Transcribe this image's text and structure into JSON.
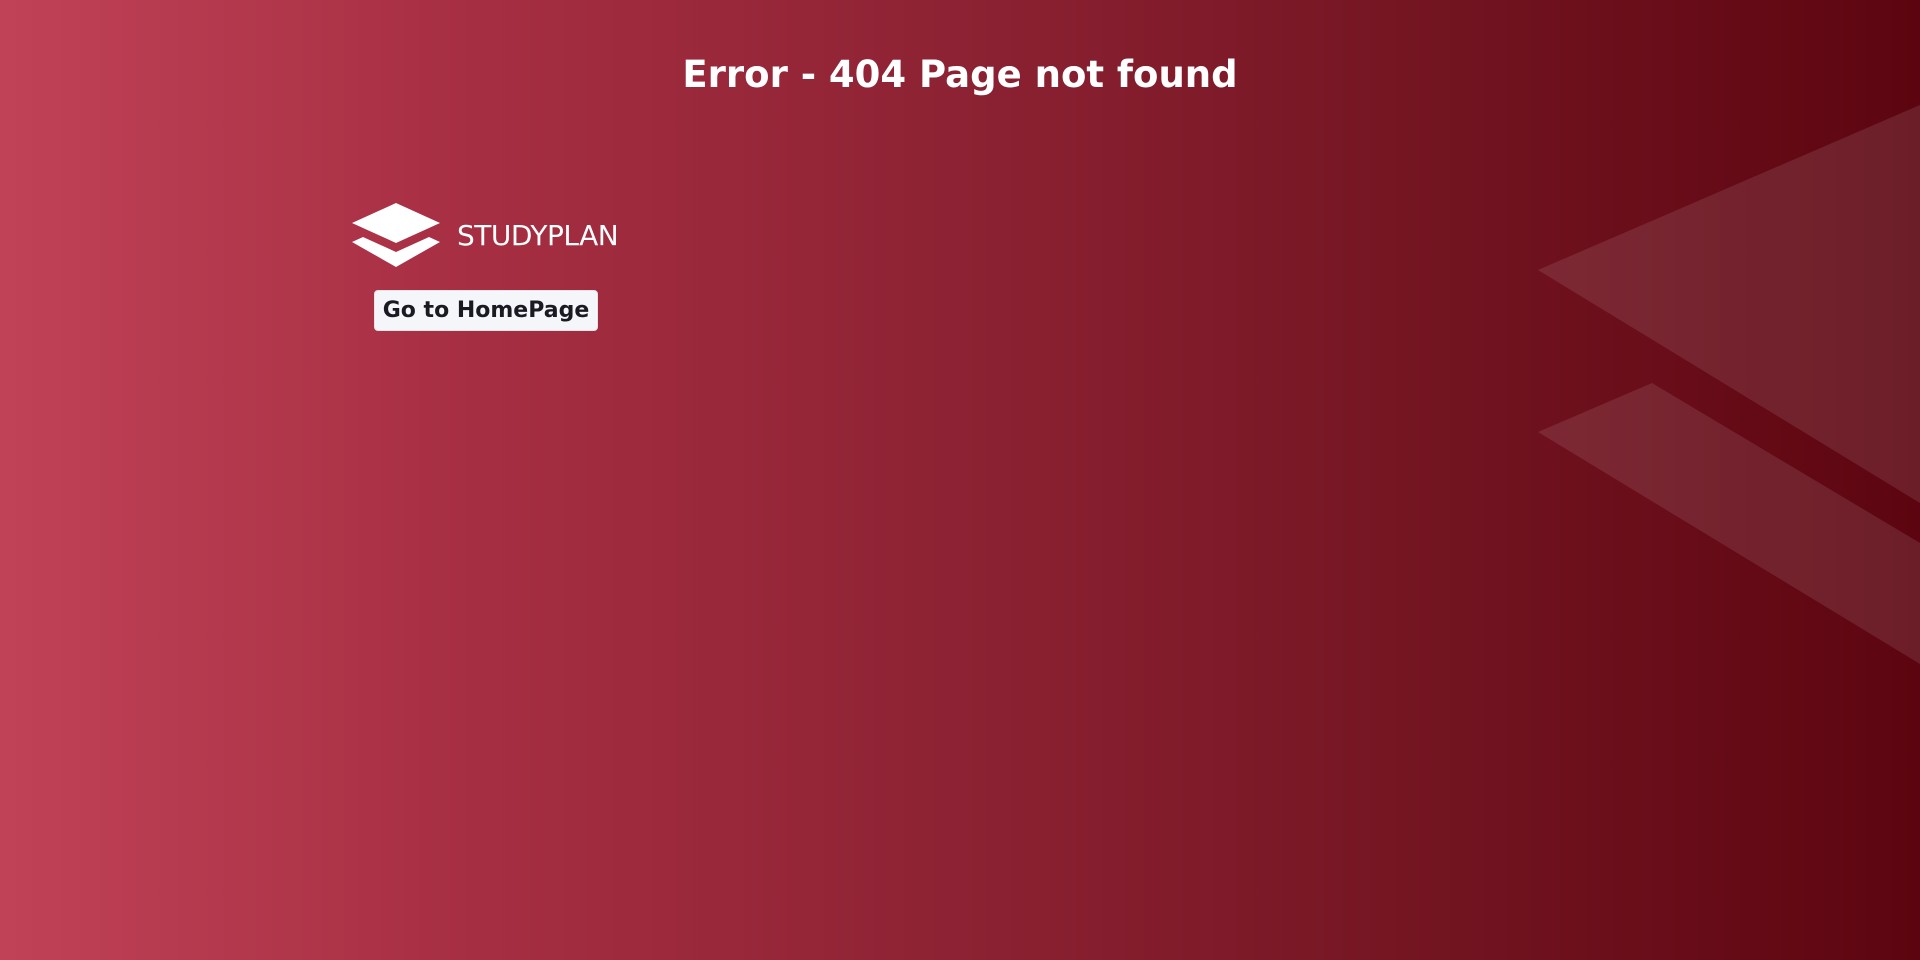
{
  "header": {
    "title": "Error - 404 Page not found"
  },
  "brand": {
    "name": "STUDYPLAN",
    "icon": "stacked-layers-icon"
  },
  "actions": {
    "home_label": "Go to HomePage"
  },
  "colors": {
    "gradient_start": "#c04257",
    "gradient_end": "#5c0510",
    "text": "#ffffff",
    "button_bg": "#f5f6fa",
    "button_text": "#1a1a22"
  }
}
